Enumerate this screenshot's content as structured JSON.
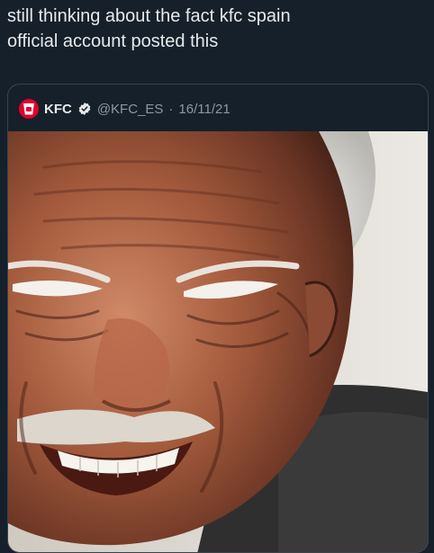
{
  "post": {
    "text": "still thinking about the fact kfc spain\nofficial account posted this"
  },
  "quote": {
    "name": "KFC",
    "handle": "@KFC_ES",
    "separator": "·",
    "date": "16/11/21",
    "verified": true,
    "brand_color": "#e4002b"
  },
  "media": {
    "icon": "edited-photo-old-man-grinning"
  }
}
